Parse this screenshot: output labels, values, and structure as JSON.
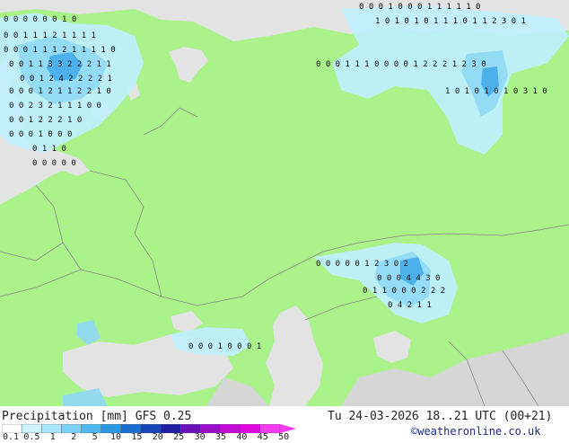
{
  "map": {
    "colors": {
      "land": "#aaf28a",
      "water": "#e3e3e3",
      "nodata_land": "#d6d6d6",
      "precip_light": "#bfefff",
      "precip_medium": "#8fd8f6",
      "precip_heavy": "#3aa6e8",
      "border": "#8a8a8a"
    },
    "grid_labels": [
      {
        "row": 0,
        "text": "0 0 0 0 0 0 1 0"
      },
      {
        "row": 1,
        "text": "0 0 1 1 1 2 1 1 1 1"
      },
      {
        "row": 2,
        "text": "0 0 0 1 1 1 2 1 1 1 1 0"
      },
      {
        "row": 3,
        "text": "0 0 1 1 3 3 2 2 2 1 1"
      },
      {
        "row": 4,
        "text": "0 0 1 2 4 2 2 2 2 1"
      },
      {
        "row": 5,
        "text": "0 0 0 1 2 1 1 2 2 1 0"
      },
      {
        "row": 6,
        "text": "0 0 2 3 2 1 1 1 0 0"
      },
      {
        "row": 7,
        "text": "0 0 1 2 2 2 1 0"
      },
      {
        "row": 8,
        "text": "0 0 0 1 0 0 0"
      },
      {
        "row": 9,
        "text": "0 1 1 0"
      },
      {
        "row": 10,
        "text": "0 0 0 0 0"
      },
      {
        "row": 11,
        "text": "0 0 0 1 0 0 0 1 1 1 1 1 0"
      },
      {
        "row": 12,
        "text": "1 0 1 0 1 0 1 1 1 0 1 1 2 3 0 1"
      },
      {
        "row": 13,
        "text": "0 0 0 1 1 1 0 0 0 0 1 2 2 2 1 2 3 0"
      },
      {
        "row": 14,
        "text": "1 0 1 0 1 0 1 0 3 1 0"
      },
      {
        "row": 15,
        "text": "0 0 0 0 0 1 2 3 0 2"
      },
      {
        "row": 16,
        "text": "0 0 0 4 4 3 0"
      },
      {
        "row": 17,
        "text": "0 1 1 0 0 0 2 2 2"
      },
      {
        "row": 18,
        "text": "0 4 2 1 1"
      },
      {
        "row": 19,
        "text": "0 0 0 1 0 0 0 1"
      }
    ]
  },
  "legend": {
    "title": "Precipitation [mm]  GFS 0.25",
    "datetime": "Tu 24-03-2026 18..21 UTC (00+21)",
    "credit": "©weatheronline.co.uk",
    "ticks": [
      "0.1",
      "0.5",
      "1",
      "2",
      "5",
      "10",
      "15",
      "20",
      "25",
      "30",
      "35",
      "40",
      "45",
      "50"
    ],
    "colors": [
      "#ffffff",
      "#cdf3ff",
      "#a8e6fb",
      "#7cd2f6",
      "#4db9ef",
      "#2a96e0",
      "#1c6fd0",
      "#1745b8",
      "#2020a0",
      "#6a14b8",
      "#9a10c8",
      "#c40cd6",
      "#e00ae0",
      "#f23cf0"
    ]
  }
}
